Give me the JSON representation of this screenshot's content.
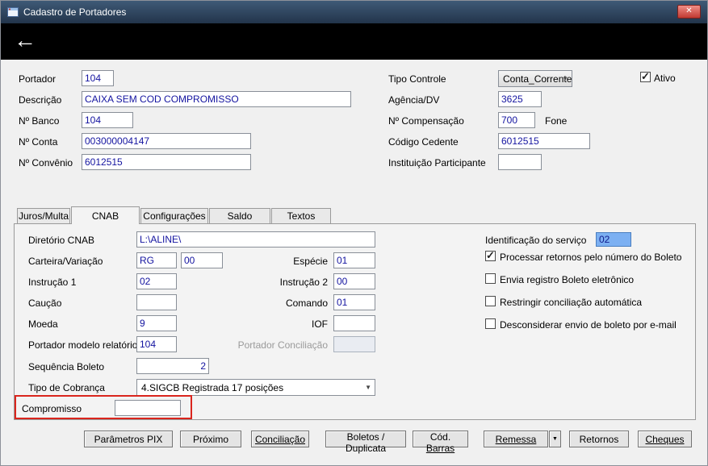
{
  "icons": {
    "back": "←",
    "close": "✕",
    "dropdown": "▼"
  },
  "window": {
    "title": "Cadastro de Portadores"
  },
  "general": {
    "portador": {
      "label": "Portador",
      "value": "104"
    },
    "descricao": {
      "label": "Descrição",
      "value": "CAIXA SEM COD COMPROMISSO"
    },
    "banco": {
      "label": "Nº Banco",
      "value": "104"
    },
    "conta": {
      "label": "Nº Conta",
      "value": "003000004147"
    },
    "convenio": {
      "label": "Nº Convênio",
      "value": "6012515"
    },
    "tipo_controle": {
      "label": "Tipo Controle",
      "value": "Conta_Corrente"
    },
    "agencia": {
      "label": "Agência/DV",
      "value": "3625"
    },
    "compensacao": {
      "label": "Nº Compensação",
      "value": "700"
    },
    "fone": {
      "label": "Fone"
    },
    "cedente": {
      "label": "Código Cedente",
      "value": "6012515"
    },
    "instituicao": {
      "label": "Instituição Participante",
      "value": ""
    },
    "ativo": {
      "label": "Ativo",
      "checked": true
    }
  },
  "tabs": [
    {
      "label": "Juros/Multa",
      "selected": false
    },
    {
      "label": "CNAB",
      "selected": true
    },
    {
      "label": "Configurações",
      "selected": false
    },
    {
      "label": "Saldo",
      "selected": false
    },
    {
      "label": "Textos",
      "selected": false
    }
  ],
  "cnab": {
    "diretorio": {
      "label": "Diretório CNAB",
      "value": "L:\\ALINE\\"
    },
    "carteira": {
      "label": "Carteira/Variação",
      "value1": "RG",
      "value2": "00"
    },
    "especie": {
      "label": "Espécie",
      "value": "01"
    },
    "instrucao1": {
      "label": "Instrução 1",
      "value": "02"
    },
    "instrucao2": {
      "label": "Instrução 2",
      "value": "00"
    },
    "caucao": {
      "label": "Caução",
      "value": ""
    },
    "comando": {
      "label": "Comando",
      "value": "01"
    },
    "moeda": {
      "label": "Moeda",
      "value": "9"
    },
    "iof": {
      "label": "IOF",
      "value": ""
    },
    "portador_modelo": {
      "label": "Portador modelo relatório",
      "value": "104"
    },
    "portador_conciliacao": {
      "label": "Portador Conciliação",
      "value": "",
      "disabled": true
    },
    "sequencia_boleto": {
      "label": "Sequência Boleto",
      "value": "2"
    },
    "tipo_cobranca": {
      "label": "Tipo de Cobrança",
      "value": "4.SIGCB Registrada 17 posições"
    },
    "compromisso": {
      "label": "Compromisso",
      "value": "",
      "highlight_color": "#da251d"
    },
    "identificacao_servico": {
      "label": "Identificação do serviço",
      "value": "02",
      "selected": true
    },
    "options": [
      {
        "label": "Processar retornos pelo número do Boleto",
        "checked": true
      },
      {
        "label": "Envia registro Boleto eletrônico",
        "checked": false
      },
      {
        "label": "Restringir conciliação automática",
        "checked": false
      },
      {
        "label": "Desconsiderar envio de boleto por e-mail",
        "checked": false
      }
    ]
  },
  "buttons": {
    "parametros_pix": {
      "pre": "Parâmetros PIX",
      "u": "",
      "post": ""
    },
    "proximo": {
      "pre": "Próximo",
      "u": "",
      "post": ""
    },
    "conciliacao": {
      "pre": "",
      "u": "Conciliação",
      "post": ""
    },
    "boletos": {
      "pre": "Boletos / Duplicata",
      "u": "",
      "post": ""
    },
    "cod_barras": {
      "pre": "Cód. ",
      "u": "Barras",
      "post": ""
    },
    "remessa": {
      "pre": "",
      "u": "Remessa",
      "post": ""
    },
    "retornos": {
      "pre": "Retornos",
      "u": "",
      "post": ""
    },
    "cheques": {
      "pre": "",
      "u": "Cheques",
      "post": ""
    }
  }
}
